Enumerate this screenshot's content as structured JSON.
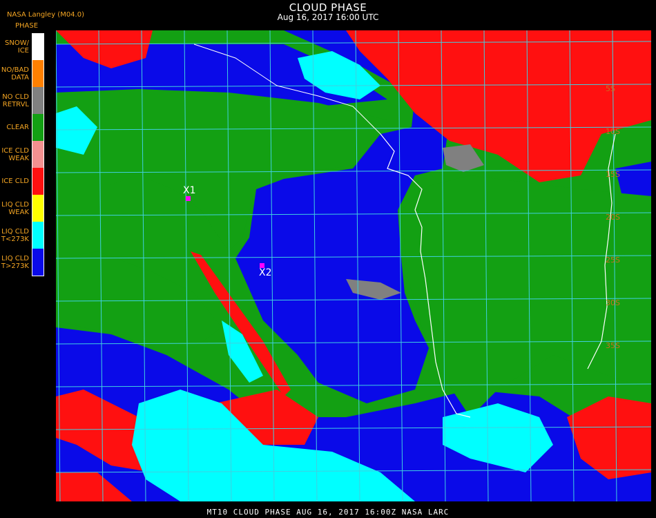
{
  "header": {
    "title": "CLOUD PHASE",
    "subtitle": "Aug 16, 2017 16:00 UTC",
    "credit": "NASA Langley (M04.0)"
  },
  "legend": {
    "title": "PHASE",
    "items": [
      {
        "label": "SNOW/\nICE",
        "color": "#ffffff"
      },
      {
        "label": "NO/BAD\nDATA",
        "color": "#ff8000"
      },
      {
        "label": "NO CLD\nRETRVL",
        "color": "#808080"
      },
      {
        "label": "CLEAR",
        "color": "#13a013"
      },
      {
        "label": "ICE CLD\nWEAK",
        "color": "#f39090"
      },
      {
        "label": "ICE CLD",
        "color": "#ff1010"
      },
      {
        "label": "LIQ CLD\nWEAK",
        "color": "#ffff00"
      },
      {
        "label": "LIQ CLD\nT<273K",
        "color": "#00ffff"
      },
      {
        "label": "LIQ CLD\nT>273K",
        "color": "#0a0ae8"
      }
    ]
  },
  "markers": [
    {
      "label": "X1"
    },
    {
      "label": "X2"
    }
  ],
  "lat_labels": [
    "5S",
    "10S",
    "15S",
    "20S",
    "25S",
    "30S",
    "35S"
  ],
  "footer": "MT10  CLOUD PHASE   AUG 16, 2017 16:00Z  NASA LARC",
  "colors": {
    "grid": "#40d0e0",
    "coast": "#ffffff",
    "lat_label": "#c87020",
    "marker": "#ff00ff"
  }
}
